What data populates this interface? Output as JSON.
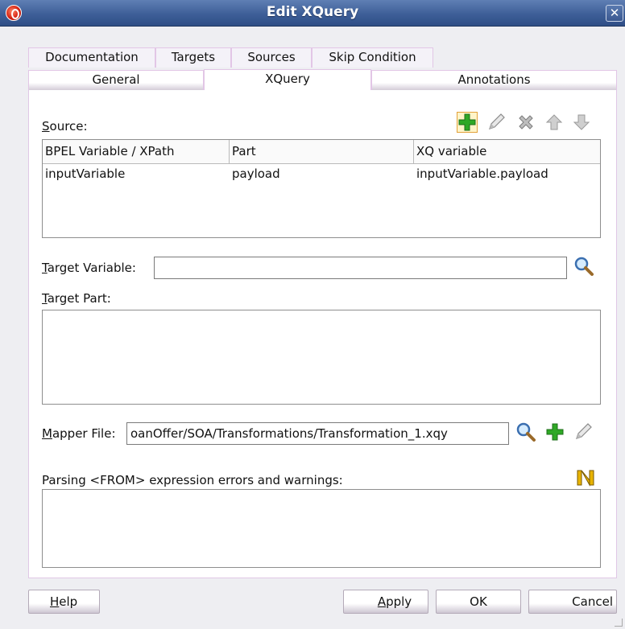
{
  "window": {
    "title": "Edit XQuery",
    "close_glyph": "✕"
  },
  "tabs_row1": [
    {
      "label": "Documentation"
    },
    {
      "label": "Targets"
    },
    {
      "label": "Sources"
    },
    {
      "label": "Skip Condition"
    }
  ],
  "tabs_row2": [
    {
      "label": "General",
      "active": false
    },
    {
      "label": "XQuery",
      "active": true
    },
    {
      "label": "Annotations",
      "active": false
    }
  ],
  "source": {
    "label": "Source:",
    "label_mnemonic": "S",
    "label_rest": "ource:",
    "toolbar": [
      "add-icon",
      "edit-icon",
      "delete-icon",
      "move-up-icon",
      "move-down-icon"
    ],
    "columns": [
      "BPEL Variable / XPath",
      "Part",
      "XQ variable"
    ],
    "rows": [
      [
        "inputVariable",
        "payload",
        "inputVariable.payload"
      ]
    ]
  },
  "target_variable": {
    "label_mnemonic": "T",
    "label_rest": "arget Variable:",
    "value": ""
  },
  "target_part": {
    "label_mnemonic": "T",
    "label_rest": "arget Part:"
  },
  "mapper_file": {
    "label_mnemonic": "M",
    "label_rest": "apper File:",
    "value": "oanOffer/SOA/Transformations/Transformation_1.xqy"
  },
  "parsing": {
    "label": "Parsing <FROM> expression errors and warnings:"
  },
  "buttons": {
    "help_mnemonic": "H",
    "help_rest": "elp",
    "apply_mnemonic": "A",
    "apply_rest": "pply",
    "ok": "OK",
    "cancel": "Cancel"
  },
  "colors": {
    "title_bar": "#3e5f98",
    "add_icon": "#2fa826",
    "tab_border": "#e2c6e6"
  }
}
